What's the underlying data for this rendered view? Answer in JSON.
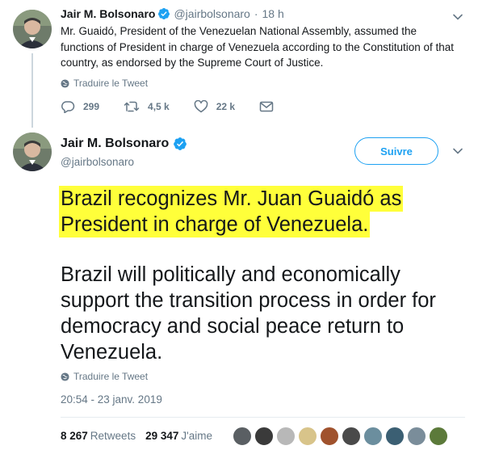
{
  "reply": {
    "author_name": "Jair M. Bolsonaro",
    "handle": "@jairbolsonaro",
    "separator": "·",
    "time": "18 h",
    "text": "Mr. Guaidó, President of the Venezuelan National Assembly, assumed the functions of President in charge of Venezuela according to the Constitution of that country, as endorsed by the Supreme Court of Justice.",
    "translate_label": "Traduire le Tweet",
    "replies_count": "299",
    "retweets_count": "4,5 k",
    "likes_count": "22 k"
  },
  "main": {
    "author_name": "Jair M. Bolsonaro",
    "handle": "@jairbolsonaro",
    "follow_label": "Suivre",
    "highlighted_line1": "Brazil recognizes Mr. Juan Guaidó as",
    "highlighted_line2": "President in charge of Venezuela.",
    "paragraph2": "Brazil will politically and economically support the transition process in order for democracy and social peace return to Venezuela.",
    "translate_label": "Traduire le Tweet",
    "timestamp": "20:54 - 23 janv. 2019",
    "retweets_value": "8 267",
    "retweets_label": "Retweets",
    "likes_value": "29 347",
    "likes_label": "J'aime"
  },
  "colors": {
    "accent": "#1da1f2",
    "highlight": "#ffff3a",
    "muted": "#657786"
  },
  "liker_colors": [
    "#5a5f63",
    "#3a3a3a",
    "#b8b8b8",
    "#d8c48a",
    "#a0522d",
    "#4a4a4a",
    "#6b8e9e",
    "#3b5f73",
    "#7a8d9a",
    "#5c7a3a"
  ]
}
